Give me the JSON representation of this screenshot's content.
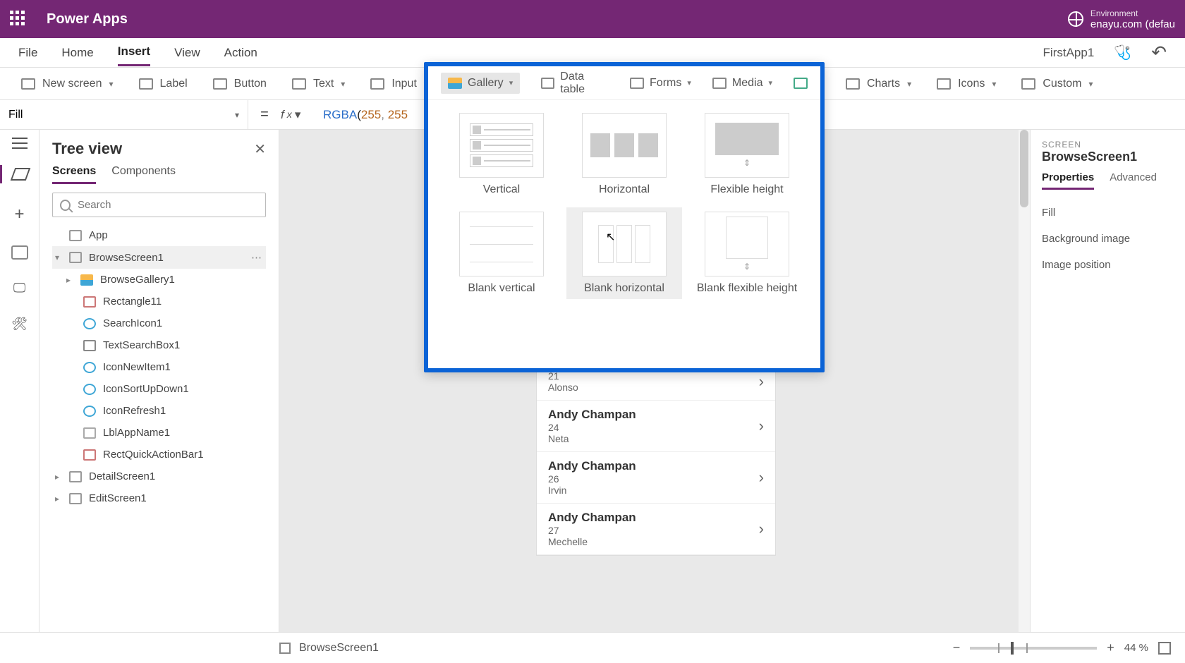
{
  "titlebar": {
    "brand": "Power Apps",
    "env_label": "Environment",
    "env_value": "enayu.com (defau"
  },
  "menubar": {
    "items": [
      "File",
      "Home",
      "Insert",
      "View",
      "Action"
    ],
    "active": "Insert",
    "appname": "FirstApp1"
  },
  "ribbon": {
    "new_screen": "New screen",
    "label": "Label",
    "button": "Button",
    "text": "Text",
    "input": "Input",
    "gallery": "Gallery",
    "datatable": "Data table",
    "forms": "Forms",
    "media": "Media",
    "charts": "Charts",
    "icons": "Icons",
    "custom": "Custom"
  },
  "formula": {
    "prop": "Fill",
    "fn": "RGBA",
    "args": [
      "255",
      "255"
    ]
  },
  "tree": {
    "title": "Tree view",
    "tabs": [
      "Screens",
      "Components"
    ],
    "active_tab": "Screens",
    "search_placeholder": "Search",
    "app": "App",
    "screens": [
      {
        "name": "BrowseScreen1",
        "selected": true,
        "children": [
          {
            "name": "BrowseGallery1",
            "icon": "gal",
            "caret": true
          },
          {
            "name": "Rectangle11",
            "icon": "rect"
          },
          {
            "name": "SearchIcon1",
            "icon": "srch"
          },
          {
            "name": "TextSearchBox1",
            "icon": "txt"
          },
          {
            "name": "IconNewItem1",
            "icon": "srch"
          },
          {
            "name": "IconSortUpDown1",
            "icon": "srch"
          },
          {
            "name": "IconRefresh1",
            "icon": "srch"
          },
          {
            "name": "LblAppName1",
            "icon": "lbl"
          },
          {
            "name": "RectQuickActionBar1",
            "icon": "rect"
          }
        ]
      },
      {
        "name": "DetailScreen1"
      },
      {
        "name": "EditScreen1"
      }
    ]
  },
  "gallery_flyout": {
    "buttons": {
      "gallery": "Gallery",
      "datatable": "Data table",
      "forms": "Forms",
      "media": "Media"
    },
    "options": [
      "Vertical",
      "Horizontal",
      "Flexible height",
      "Blank vertical",
      "Blank horizontal",
      "Blank flexible height"
    ],
    "hover_index": 4
  },
  "phone_rows": [
    {
      "name": "",
      "sub1": "21",
      "sub2": "Alonso"
    },
    {
      "name": "Andy Champan",
      "sub1": "24",
      "sub2": "Neta"
    },
    {
      "name": "Andy Champan",
      "sub1": "26",
      "sub2": "Irvin"
    },
    {
      "name": "Andy Champan",
      "sub1": "27",
      "sub2": "Mechelle"
    }
  ],
  "props": {
    "sc": "SCREEN",
    "name": "BrowseScreen1",
    "tabs": [
      "Properties",
      "Advanced"
    ],
    "active": "Properties",
    "rows": [
      "Fill",
      "Background image",
      "Image position"
    ]
  },
  "footer": {
    "screen": "BrowseScreen1",
    "zoom": "44",
    "pct": "%"
  }
}
